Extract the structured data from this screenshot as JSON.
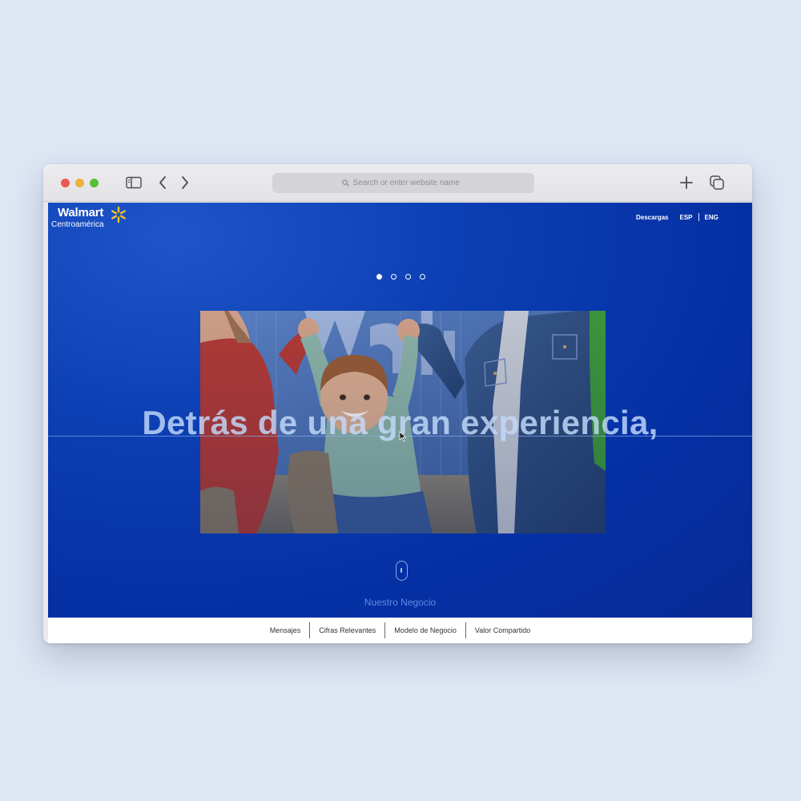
{
  "browser": {
    "address_placeholder": "Search or enter website name"
  },
  "site": {
    "brand": "Walmart",
    "brand_sub": "Centroamérica",
    "colors": {
      "hero_blue": "#0a3ab0",
      "spark_yellow": "#ffc220",
      "accent_text": "#5f8ee2"
    },
    "top_nav": {
      "downloads": "Descargas",
      "lang_es": "ESP",
      "lang_en": "ENG"
    },
    "carousel": {
      "total_slides": 4,
      "active_slide": 1
    },
    "headline": "Detrás de una gran experiencia,",
    "scroll_label": "Nuestro Negocio",
    "bottom_nav": [
      {
        "label": "Mensajes"
      },
      {
        "label": "Cifras Relevantes"
      },
      {
        "label": "Modelo de Negocio"
      },
      {
        "label": "Valor Compartido"
      }
    ]
  }
}
